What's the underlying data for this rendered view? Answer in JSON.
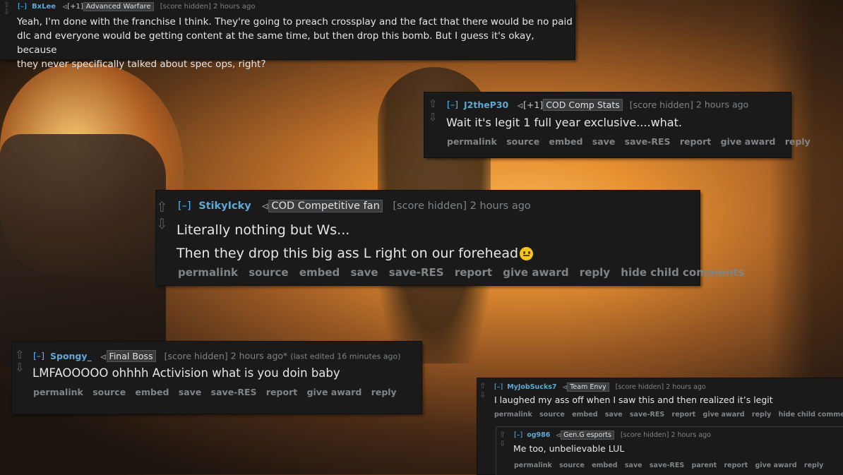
{
  "comments": {
    "bxlee": {
      "toggle": "[–]",
      "author": "BxLee",
      "plus": "[+1]",
      "flair": "Advanced Warfare",
      "score": "[score hidden]",
      "time": "2 hours ago",
      "line1": "Yeah, I'm done with the franchise I think. They're going to preach crossplay and the fact that there would be no paid",
      "line2": "dlc and everyone would be getting content at the same time, but then drop this bomb. But I guess it's okay, because",
      "line3": "they never specifically talked about spec ops, right?"
    },
    "j2thep30": {
      "toggle": "[–]",
      "author": "J2theP30",
      "plus": "[+1]",
      "flair": "COD Comp Stats",
      "score": "[score hidden]",
      "time": "2 hours ago",
      "line1": "Wait it's legit 1 full year exclusive....what.",
      "links": [
        "permalink",
        "source",
        "embed",
        "save",
        "save-RES",
        "report",
        "give award",
        "reply"
      ]
    },
    "stikyicky": {
      "toggle": "[–]",
      "author": "StikyIcky",
      "flair": "COD Competitive fan",
      "score": "[score hidden]",
      "time": "2 hours ago",
      "line1": "Literally nothing but Ws...",
      "line2": "Then they drop this big ass L right on our forehead",
      "links": [
        "permalink",
        "source",
        "embed",
        "save",
        "save-RES",
        "report",
        "give award",
        "reply",
        "hide child comments"
      ]
    },
    "spongy": {
      "toggle": "[–]",
      "author": "Spongy_",
      "flair": "Final Boss",
      "score": "[score hidden]",
      "time": "2 hours ago*",
      "edited": "(last edited 16 minutes ago)",
      "line1": "LMFAOOOOO ohhhh Activision what is you doin baby",
      "links": [
        "permalink",
        "source",
        "embed",
        "save",
        "save-RES",
        "report",
        "give award",
        "reply"
      ]
    },
    "myjobsucks": {
      "toggle": "[–]",
      "author": "MyJobSucks7",
      "flair": "Team Envy",
      "score": "[score hidden]",
      "time": "2 hours ago",
      "line1": "I laughed my ass off when I saw this and then realized it’s legit",
      "links": [
        "permalink",
        "source",
        "embed",
        "save",
        "save-RES",
        "report",
        "give award",
        "reply",
        "hide child comments"
      ]
    },
    "og986": {
      "toggle": "[–]",
      "author": "og986",
      "flair": "Gen.G esports",
      "score": "[score hidden]",
      "time": "2 hours ago",
      "line1": "Me too, unbelievable LUL",
      "links": [
        "permalink",
        "source",
        "embed",
        "save",
        "save-RES",
        "parent",
        "report",
        "give award",
        "reply"
      ]
    }
  },
  "icons": {
    "upvote": "upvote-arrow-icon",
    "downvote": "downvote-arrow-icon",
    "flair_tag": "tag-icon",
    "emoji": "neutral-face-emoji-icon"
  }
}
